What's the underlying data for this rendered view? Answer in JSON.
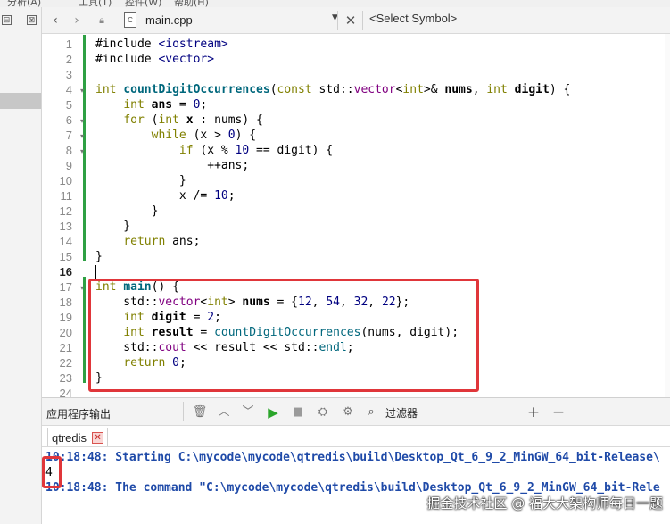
{
  "menu": {
    "items": [
      "分析(A)",
      "工具(T)",
      "控件(W)",
      "帮助(H)"
    ]
  },
  "editor": {
    "file_name": "main.cpp",
    "symbol_placeholder": "<Select Symbol>",
    "current_line": 16
  },
  "code_lines": [
    {
      "n": 1,
      "tokens": [
        [
          "t",
          "#include "
        ],
        [
          "nm",
          "<iostream>"
        ]
      ]
    },
    {
      "n": 2,
      "tokens": [
        [
          "t",
          "#include "
        ],
        [
          "nm",
          "<vector>"
        ]
      ]
    },
    {
      "n": 3,
      "tokens": []
    },
    {
      "n": 4,
      "tokens": [
        [
          "kw",
          "int "
        ],
        [
          "fnb",
          "countDigitOccurrences"
        ],
        [
          "t",
          "("
        ],
        [
          "kw",
          "const "
        ],
        [
          "t",
          "std::"
        ],
        [
          "ty",
          "vector"
        ],
        [
          "t",
          "<"
        ],
        [
          "kw",
          "int"
        ],
        [
          "t",
          ">& "
        ],
        [
          "b",
          "nums"
        ],
        [
          "t",
          ", "
        ],
        [
          "kw",
          "int "
        ],
        [
          "b",
          "digit"
        ],
        [
          "t",
          ") {"
        ]
      ]
    },
    {
      "n": 5,
      "tokens": [
        [
          "t",
          "    "
        ],
        [
          "kw",
          "int "
        ],
        [
          "b",
          "ans"
        ],
        [
          "t",
          " = "
        ],
        [
          "nm",
          "0"
        ],
        [
          "t",
          ";"
        ]
      ]
    },
    {
      "n": 6,
      "tokens": [
        [
          "t",
          "    "
        ],
        [
          "kw",
          "for "
        ],
        [
          "t",
          "("
        ],
        [
          "kw",
          "int "
        ],
        [
          "b",
          "x"
        ],
        [
          "t",
          " : nums) {"
        ]
      ]
    },
    {
      "n": 7,
      "tokens": [
        [
          "t",
          "        "
        ],
        [
          "kw",
          "while "
        ],
        [
          "t",
          "(x > "
        ],
        [
          "nm",
          "0"
        ],
        [
          "t",
          ") {"
        ]
      ]
    },
    {
      "n": 8,
      "tokens": [
        [
          "t",
          "            "
        ],
        [
          "kw",
          "if "
        ],
        [
          "t",
          "(x % "
        ],
        [
          "nm",
          "10"
        ],
        [
          "t",
          " == digit) {"
        ]
      ]
    },
    {
      "n": 9,
      "tokens": [
        [
          "t",
          "                ++ans;"
        ]
      ]
    },
    {
      "n": 10,
      "tokens": [
        [
          "t",
          "            }"
        ]
      ]
    },
    {
      "n": 11,
      "tokens": [
        [
          "t",
          "            x /= "
        ],
        [
          "nm",
          "10"
        ],
        [
          "t",
          ";"
        ]
      ]
    },
    {
      "n": 12,
      "tokens": [
        [
          "t",
          "        }"
        ]
      ]
    },
    {
      "n": 13,
      "tokens": [
        [
          "t",
          "    }"
        ]
      ]
    },
    {
      "n": 14,
      "tokens": [
        [
          "t",
          "    "
        ],
        [
          "kw",
          "return "
        ],
        [
          "t",
          "ans;"
        ]
      ]
    },
    {
      "n": 15,
      "tokens": [
        [
          "t",
          "}"
        ]
      ]
    },
    {
      "n": 16,
      "tokens": []
    },
    {
      "n": 17,
      "tokens": [
        [
          "kw",
          "int "
        ],
        [
          "fnb",
          "main"
        ],
        [
          "t",
          "() {"
        ]
      ]
    },
    {
      "n": 18,
      "tokens": [
        [
          "t",
          "    std::"
        ],
        [
          "ty",
          "vector"
        ],
        [
          "t",
          "<"
        ],
        [
          "kw",
          "int"
        ],
        [
          "t",
          "> "
        ],
        [
          "b",
          "nums"
        ],
        [
          "t",
          " = {"
        ],
        [
          "nm",
          "12"
        ],
        [
          "t",
          ", "
        ],
        [
          "nm",
          "54"
        ],
        [
          "t",
          ", "
        ],
        [
          "nm",
          "32"
        ],
        [
          "t",
          ", "
        ],
        [
          "nm",
          "22"
        ],
        [
          "t",
          "};"
        ]
      ]
    },
    {
      "n": 19,
      "tokens": [
        [
          "t",
          "    "
        ],
        [
          "kw",
          "int "
        ],
        [
          "b",
          "digit"
        ],
        [
          "t",
          " = "
        ],
        [
          "nm",
          "2"
        ],
        [
          "t",
          ";"
        ]
      ]
    },
    {
      "n": 20,
      "tokens": [
        [
          "t",
          "    "
        ],
        [
          "kw",
          "int "
        ],
        [
          "b",
          "result"
        ],
        [
          "t",
          " = "
        ],
        [
          "fn",
          "countDigitOccurrences"
        ],
        [
          "t",
          "(nums, digit);"
        ]
      ]
    },
    {
      "n": 21,
      "tokens": [
        [
          "t",
          "    std::"
        ],
        [
          "ty",
          "cout"
        ],
        [
          "t",
          " << result << std::"
        ],
        [
          "fn",
          "endl"
        ],
        [
          "t",
          ";"
        ]
      ]
    },
    {
      "n": 22,
      "tokens": [
        [
          "t",
          "    "
        ],
        [
          "kw",
          "return "
        ],
        [
          "nm",
          "0"
        ],
        [
          "t",
          ";"
        ]
      ]
    },
    {
      "n": 23,
      "tokens": [
        [
          "t",
          "}"
        ]
      ]
    },
    {
      "n": 24,
      "tokens": []
    }
  ],
  "output": {
    "title": "应用程序输出",
    "filter_label": "过滤器",
    "tab_label": "qtredis",
    "lines": [
      {
        "kind": "sys",
        "text": "10:18:48: Starting C:\\mycode\\mycode\\qtredis\\build\\Desktop_Qt_6_9_2_MinGW_64_bit-Release\\"
      },
      {
        "kind": "plain",
        "text": "4"
      },
      {
        "kind": "sys",
        "text": "10:18:48: The command \"C:\\mycode\\mycode\\qtredis\\build\\Desktop_Qt_6_9_2_MinGW_64_bit-Rele"
      }
    ]
  },
  "watermark": "掘金技术社区 @ 福大大架构师每日一题",
  "colors": {
    "highlight_box": "#e0363a",
    "keyword": "#808000",
    "number": "#000080",
    "type": "#800080",
    "function": "#00677c",
    "output_sys": "#1f4aa8"
  },
  "icons": [
    "back-icon",
    "forward-icon",
    "lock-icon",
    "file-icon",
    "close-icon",
    "trash-icon",
    "up-icon",
    "down-icon",
    "run-icon",
    "stop-icon",
    "attach-icon",
    "gear-icon",
    "plus-icon",
    "minus-icon"
  ]
}
